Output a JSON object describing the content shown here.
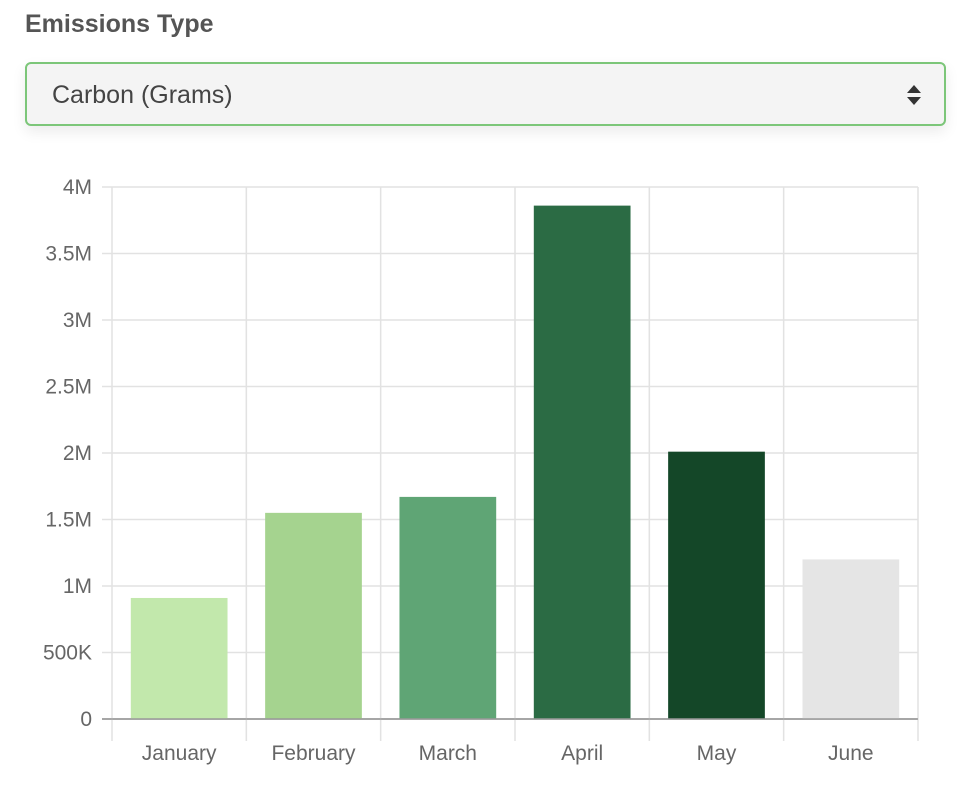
{
  "form": {
    "label": "Emissions Type",
    "selected": "Carbon (Grams)"
  },
  "icons": {
    "select_arrows": "sort-arrows-icon"
  },
  "chart_data": {
    "type": "bar",
    "categories": [
      "January",
      "February",
      "March",
      "April",
      "May",
      "June"
    ],
    "values": [
      910000,
      1550000,
      1670000,
      3860000,
      2010000,
      1200000
    ],
    "colors": [
      "#c2e8ac",
      "#a5d38f",
      "#5fa575",
      "#2b6b44",
      "#144728",
      "#e5e5e5"
    ],
    "ylim": [
      0,
      4000000
    ],
    "yticks": [
      0,
      500000,
      1000000,
      1500000,
      2000000,
      2500000,
      3000000,
      3500000,
      4000000
    ],
    "ytick_labels": [
      "0",
      "500K",
      "1M",
      "1.5M",
      "2M",
      "2.5M",
      "3M",
      "3.5M",
      "4M"
    ],
    "grid": true,
    "title": "",
    "xlabel": "",
    "ylabel": ""
  }
}
